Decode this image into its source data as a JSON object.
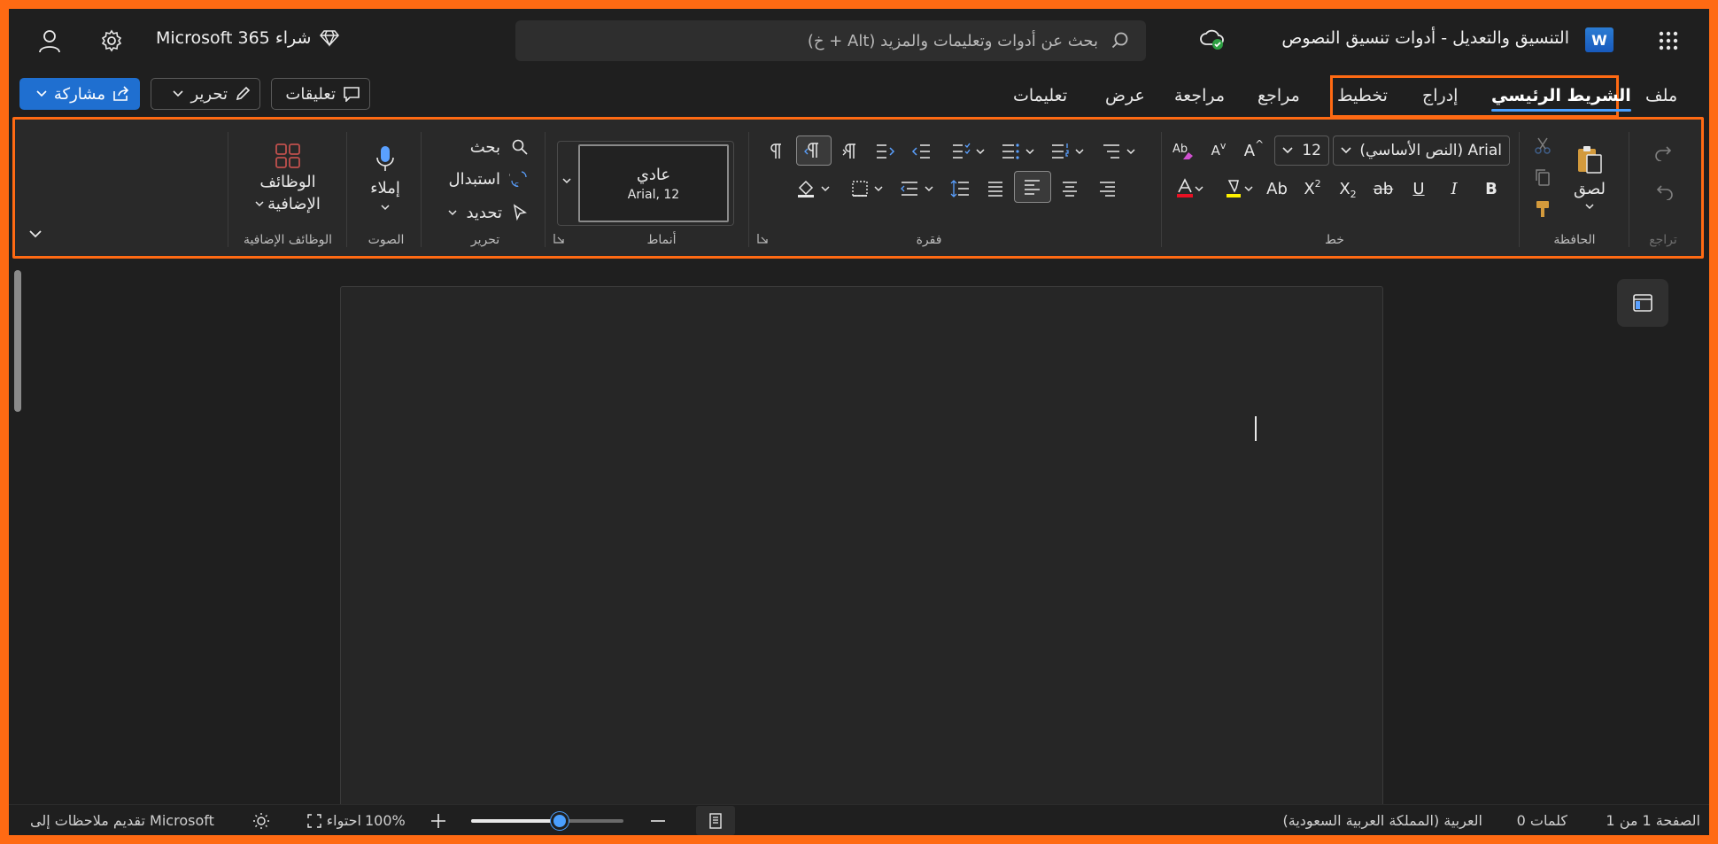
{
  "titlebar": {
    "doc_title": "التنسيق والتعديل - أدوات تنسيق النصوص",
    "app_icon": "word-icon",
    "app_letter": "W",
    "search_placeholder": "بحث عن أدوات وتعليمات والمزيد (Alt + خ)",
    "buy_label": "شراء Microsoft 365",
    "save_status_icon": "cloud-saved-icon"
  },
  "tabs": [
    {
      "label": "ملف",
      "active": false
    },
    {
      "label": "الشريط الرئيسي",
      "active": true
    },
    {
      "label": "إدراج",
      "active": false
    },
    {
      "label": "تخطيط",
      "active": false
    },
    {
      "label": "مراجع",
      "active": false
    },
    {
      "label": "مراجعة",
      "active": false
    },
    {
      "label": "عرض",
      "active": false
    },
    {
      "label": "تعليمات",
      "active": false
    }
  ],
  "actions": {
    "comments": "تعليقات",
    "editing": "تحرير",
    "share": "مشاركة"
  },
  "ribbon": {
    "groups": {
      "undo": "تراجع",
      "clipboard": "الحافظة",
      "font": "خط",
      "paragraph": "فقرة",
      "styles": "أنماط",
      "editing": "تحرير",
      "voice": "الصوت",
      "addins": "الوظائف الإضافية"
    },
    "paste_label": "لصق",
    "font_name": "Arial (النص الأساسي)",
    "font_size": "12",
    "style_name": "عادي",
    "style_detail": "Arial, 12",
    "find": "بحث",
    "replace": "استبدال",
    "select": "تحديد",
    "dictate": "إملاء",
    "addins_line1": "الوظائف",
    "addins_line2": "الإضافية",
    "font_buttons": {
      "bold": "B",
      "italic": "I",
      "underline": "U",
      "strike": "ab",
      "subscript": "X",
      "superscript": "X",
      "change_case": "Ab",
      "grow": "A",
      "shrink": "A"
    },
    "colors": {
      "font_color_bar": "#e81123",
      "highlight_bar": "#fff100",
      "addins_icon": "#c0504d",
      "accent": "#4a9fff"
    }
  },
  "status": {
    "page": "الصفحة 1 من 1",
    "words": "0 كلمات",
    "language": "العربية (المملكة العربية السعودية)",
    "zoom": "100%",
    "fit": "احتواء",
    "feedback": "تقديم ملاحظات إلى Microsoft",
    "zoom_slider_value": 0.58
  }
}
